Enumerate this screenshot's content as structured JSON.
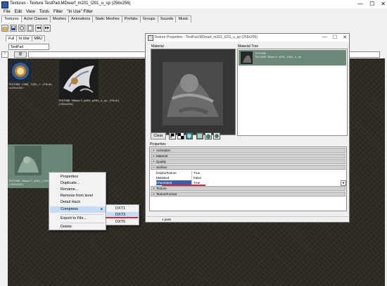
{
  "window": {
    "title": "Textures - Texture TestPad.MDwarf_m201_t201_u_sp (256x256)",
    "minimize": "—",
    "maximize": "☐",
    "close": "✕"
  },
  "menu": [
    "File",
    "Edit",
    "View",
    "Tools",
    "Filter",
    "\"In Use\" Filter"
  ],
  "tabs": [
    "Textures",
    "Actor Classes",
    "Meshes",
    "Animations",
    "Static Meshes",
    "Prefabs",
    "Groups",
    "Sounds",
    "Music"
  ],
  "toolbar": {
    "back_label": "◂◂",
    "forward_label": "▸▸"
  },
  "subtabs": [
    "Full",
    "In Use",
    "MRU"
  ],
  "package_combo": "TestPad",
  "filter": {
    "checkbox_label": "!",
    "button_label": "@",
    "value": ""
  },
  "thumbnails": [
    {
      "label": "TEXTURE CUBE_T201_r (P8x8)\n<128x128>"
    },
    {
      "label": "TEXTURE MDwarf_m201_w201_u_sp (P8x8)\n(256x256)"
    },
    {
      "label": "TEXTURE MDwarf_m201_t201_u_sp\n(256x256)"
    }
  ],
  "texture_properties": {
    "title": "Texture Properties - TestPad.MDwarf_m201_t201_u_sp (256x256)",
    "material_label": "Material",
    "material_tree_label": "Material Tree",
    "tree_item_text": "TEXTURE\nTEXTURE MDwarf_m201_t201_u_sp",
    "clear_label": "Clear",
    "properties_label": "Properties",
    "categories": [
      {
        "sign": "+",
        "name": "Animation"
      },
      {
        "sign": "+",
        "name": "Material"
      },
      {
        "sign": "+",
        "name": "Quality"
      },
      {
        "sign": "−",
        "name": "Surface"
      }
    ],
    "surface_props": [
      {
        "name": "bAlphaTexture",
        "value": "True"
      },
      {
        "name": "bMasked",
        "value": "False"
      },
      {
        "name": "bTwoSided",
        "value": "True"
      }
    ],
    "categories_after": [
      {
        "sign": "+",
        "name": "Texture"
      },
      {
        "sign": "+",
        "name": "TextureFormat"
      }
    ],
    "status": "1 pass"
  },
  "context_menu": {
    "items": [
      "Properties",
      "Duplicate...",
      "Rename...",
      "Remove from level",
      "Detail Hack",
      "Compress",
      "Export to File...",
      "Delete"
    ],
    "submenu": [
      "DXT1",
      "DXT3",
      "DXT5"
    ]
  },
  "colors": {
    "highlight": "#c5dcf4",
    "underline": "#d8243b",
    "tree_selection": "#6c8878"
  }
}
